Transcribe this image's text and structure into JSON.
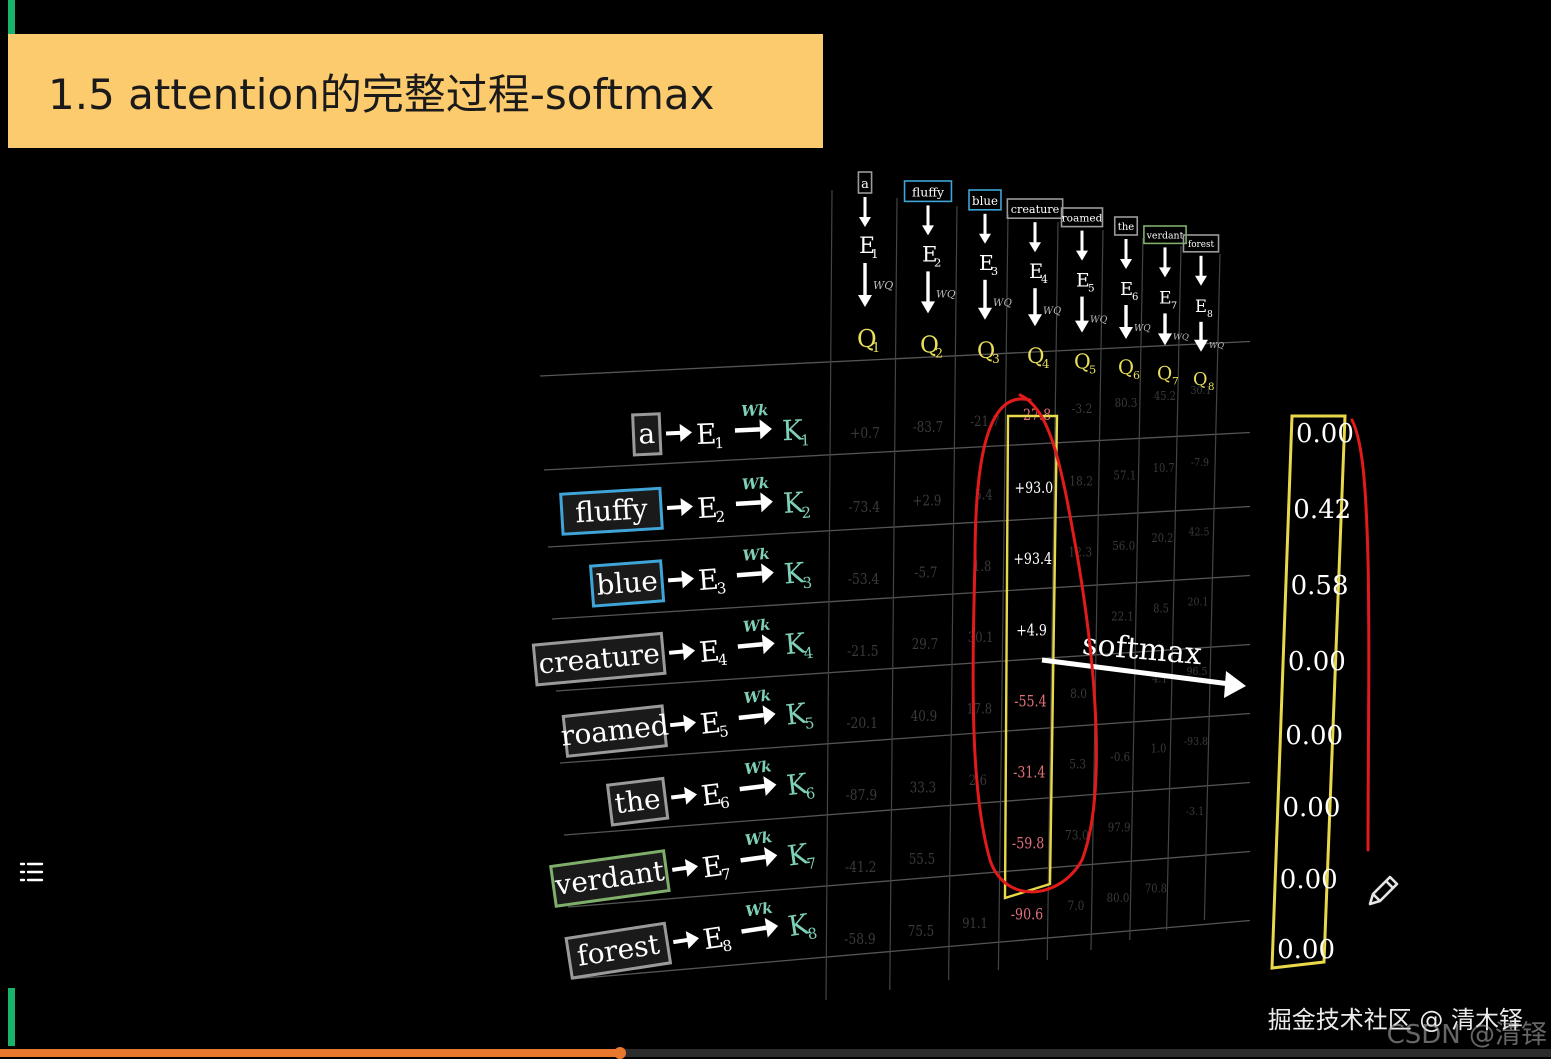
{
  "slide": {
    "title": "1.5 attention的完整过程-softmax",
    "accent_color": "#19b36b",
    "title_bg": "#fccb6d"
  },
  "columns": [
    {
      "word": "a",
      "color": "#9a9a9a",
      "embed_label": "E",
      "embed_index": "1",
      "weight_label": "WQ",
      "query_label": "Q",
      "query_index": "1"
    },
    {
      "word": "fluffy",
      "color": "#3fa4d8",
      "embed_label": "E",
      "embed_index": "2",
      "weight_label": "WQ",
      "query_label": "Q",
      "query_index": "2"
    },
    {
      "word": "blue",
      "color": "#3fa4d8",
      "embed_label": "E",
      "embed_index": "3",
      "weight_label": "WQ",
      "query_label": "Q",
      "query_index": "3"
    },
    {
      "word": "creature",
      "color": "#9a9a9a",
      "embed_label": "E",
      "embed_index": "4",
      "weight_label": "WQ",
      "query_label": "Q",
      "query_index": "4"
    },
    {
      "word": "roamed",
      "color": "#9a9a9a",
      "embed_label": "E",
      "embed_index": "5",
      "weight_label": "WQ",
      "query_label": "Q",
      "query_index": "5"
    },
    {
      "word": "the",
      "color": "#9a9a9a",
      "embed_label": "E",
      "embed_index": "6",
      "weight_label": "WQ",
      "query_label": "Q",
      "query_index": "6"
    },
    {
      "word": "verdant",
      "color": "#7fae6a",
      "embed_label": "E",
      "embed_index": "7",
      "weight_label": "WQ",
      "query_label": "Q",
      "query_index": "7"
    },
    {
      "word": "forest",
      "color": "#9a9a9a",
      "embed_label": "E",
      "embed_index": "8",
      "weight_label": "WQ",
      "query_label": "Q",
      "query_index": "8"
    }
  ],
  "rows": [
    {
      "word": "a",
      "color": "#9a9a9a",
      "embed_label": "E",
      "embed_index": "1",
      "weight_label": "Wk",
      "key_label": "K",
      "key_index": "1"
    },
    {
      "word": "fluffy",
      "color": "#3fa4d8",
      "embed_label": "E",
      "embed_index": "2",
      "weight_label": "Wk",
      "key_label": "K",
      "key_index": "2"
    },
    {
      "word": "blue",
      "color": "#3fa4d8",
      "embed_label": "E",
      "embed_index": "3",
      "weight_label": "Wk",
      "key_label": "K",
      "key_index": "3"
    },
    {
      "word": "creature",
      "color": "#9a9a9a",
      "embed_label": "E",
      "embed_index": "4",
      "weight_label": "Wk",
      "key_label": "K",
      "key_index": "4"
    },
    {
      "word": "roamed",
      "color": "#9a9a9a",
      "embed_label": "E",
      "embed_index": "5",
      "weight_label": "Wk",
      "key_label": "K",
      "key_index": "5"
    },
    {
      "word": "the",
      "color": "#9a9a9a",
      "embed_label": "E",
      "embed_index": "6",
      "weight_label": "Wk",
      "key_label": "K",
      "key_index": "6"
    },
    {
      "word": "verdant",
      "color": "#7fae6a",
      "embed_label": "E",
      "embed_index": "7",
      "weight_label": "Wk",
      "key_label": "K",
      "key_index": "7"
    },
    {
      "word": "forest",
      "color": "#9a9a9a",
      "embed_label": "E",
      "embed_index": "8",
      "weight_label": "Wk",
      "key_label": "K",
      "key_index": "8"
    }
  ],
  "grid_values": [
    [
      "+0.7",
      "-83.7",
      "-21.7",
      "-27.8",
      "-3.2",
      "80.3",
      "45.2",
      "30.1"
    ],
    [
      "-73.4",
      "+2.9",
      "5.4",
      "+93.0",
      "18.2",
      "57.1",
      "10.7",
      "-7.9"
    ],
    [
      "-53.4",
      "-5.7",
      "1.8",
      "+93.4",
      "12.3",
      "56.0",
      "20.2",
      "42.5"
    ],
    [
      "-21.5",
      "29.7",
      "30.1",
      "+4.9",
      "",
      "22.1",
      "8.5",
      "20.1"
    ],
    [
      "-20.1",
      "40.9",
      "17.8",
      "-55.4",
      "8.0",
      "",
      "4.1",
      "96.5"
    ],
    [
      "-87.9",
      "33.3",
      "2.6",
      "-31.4",
      "5.3",
      "-0.6",
      "1.0",
      "-93.8"
    ],
    [
      "-41.2",
      "55.5",
      "",
      "-59.8",
      "73.0",
      "97.9",
      "",
      "-3.1"
    ],
    [
      "-58.9",
      "75.5",
      "91.1",
      "-90.6",
      "7.0",
      "80.0",
      "70.8",
      ""
    ]
  ],
  "highlight_column": 3,
  "highlight_colors": {
    "positive": "#ffffff",
    "negative": "#e0707a",
    "box": "#e8d84a"
  },
  "softmax": {
    "label": "softmax",
    "results": [
      "0.00",
      "0.42",
      "0.58",
      "0.00",
      "0.00",
      "0.00",
      "0.00",
      "0.00"
    ]
  },
  "annotation_color": "#e11b1b",
  "icons": {
    "toc": "list-icon",
    "pen": "pencil-icon"
  },
  "watermark": {
    "line1": "掘金技术社区 @ 清木铎",
    "line2": "CSDN @清铎"
  },
  "video": {
    "progress": 0.4
  }
}
